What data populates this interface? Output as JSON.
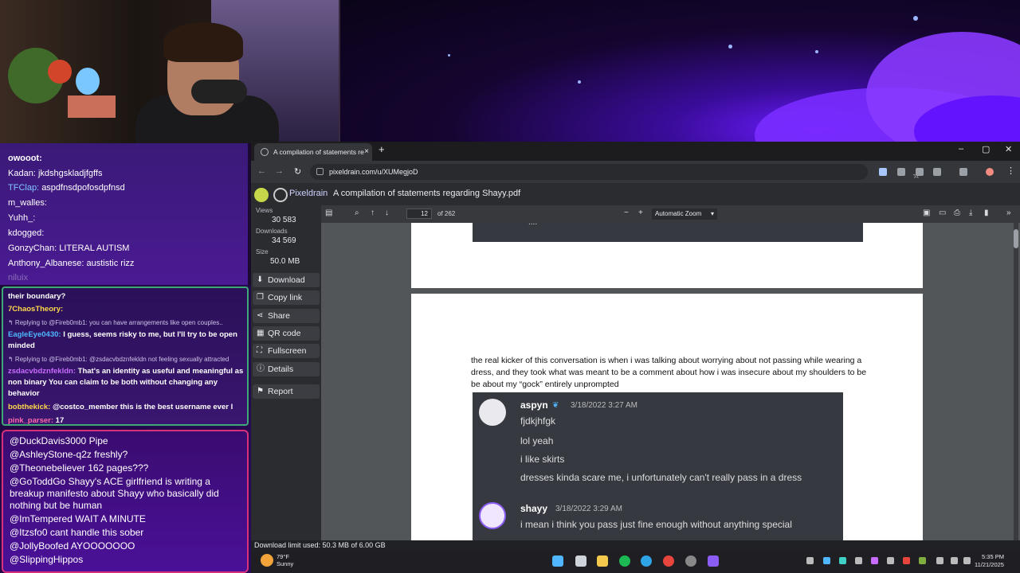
{
  "chat_top": [
    {
      "user": "owooot:",
      "msg": ""
    },
    {
      "user": "Kadan:",
      "msg": "jkdshgskladjfgffs"
    },
    {
      "user": "TFClap:",
      "msg": "aspdfnsdpofosdpfnsd"
    },
    {
      "user": "m_walles:",
      "msg": ""
    },
    {
      "user": "Yuhh_:",
      "msg": ""
    },
    {
      "user": "kdogged:",
      "msg": ""
    },
    {
      "user": "GonzyChan:",
      "msg": "LITERAL AUTISM"
    },
    {
      "user": "Anthony_Albanese:",
      "msg": "austistic rizz"
    },
    {
      "user": "niluix",
      "msg": ""
    }
  ],
  "chat_mid": {
    "l1": "their boundary?",
    "l2_user": "7ChaosTheory:",
    "l3_reply": "↰ Replying to @Fireb0mb1: you can have arrangements like open couples..",
    "l4_user": "EagleEye0430:",
    "l4_msg": "I guess, seems risky to me, but I'll try to be open minded",
    "l5_reply": "↰ Replying to @Fireb0mb1: @zsdacvbdznfekldn not feeling sexually attracted",
    "l6_user": "zsdacvbdznfekldn:",
    "l6_msg": "That's an identity as useful and meaningful as non binary  You can claim to be both without changing any behavior",
    "l7_user": "bobthekick:",
    "l7_msg": "@costco_member this is the best username ever l",
    "l8_user": "pink_parser:",
    "l8_msg": "17"
  },
  "chat_bottom": [
    {
      "user": "@DuckDavis3000",
      "msg": "Pipe"
    },
    {
      "user": "@AshleyStone-q2z",
      "msg": "freshly?"
    },
    {
      "user": "@Theonebeliever",
      "msg": "162 pages???"
    },
    {
      "user": "@GoToddGo",
      "msg": "Shayy's ACE girlfriend is writing a breakup manifesto about Shayy who basically did nothing but be human"
    },
    {
      "user": "@ImTempered",
      "msg": "WAIT A MINUTE"
    },
    {
      "user": "@Itzsfo0",
      "msg": "cant handle this sober"
    },
    {
      "user": "@JollyBoofed",
      "msg": "AYOOOOOOO"
    },
    {
      "user": "@SlippingHippos",
      "msg": ""
    }
  ],
  "browser": {
    "tab_title": "A compilation of statements re",
    "tab_close": "×",
    "new_tab": "+",
    "url": "pixeldrain.com/u/XUMegjoD",
    "win_min": "–",
    "win_max": "▢",
    "win_close": "✕",
    "back": "←",
    "forward": "→",
    "reload": "↻",
    "star": "☆",
    "menu": "⋮"
  },
  "pixeldrain": {
    "brand": "Pixeldrain",
    "file_title": "A compilation of statements regarding Shayy.pdf",
    "views_label": "Views",
    "views": "30 583",
    "downloads_label": "Downloads",
    "downloads": "34 569",
    "size_label": "Size",
    "size": "50.0 MB",
    "buttons": [
      "Download",
      "Copy link",
      "Share",
      "QR code",
      "Fullscreen",
      "Details",
      "Report"
    ]
  },
  "pdf": {
    "page": "12",
    "of_pages": "of 262",
    "zoom": "Automatic Zoom",
    "paragraph": "the real kicker of this conversation is when i was talking about worrying about not passing while wearing a dress, and they took what was meant to be a comment about how i was insecure about my shoulders to be be about my “gock” entirely unprompted",
    "ellipsis": "....",
    "msg1_user": "aspyn",
    "msg1_time": "3/18/2022 3:27 AM",
    "msg1_lines": [
      "fjdkjhfgk",
      "lol yeah",
      "i like skirts",
      "dresses kinda scare me, i unfortunately can't really pass in a dress"
    ],
    "msg2_user": "shayy",
    "msg2_time": "3/18/2022 3:29 AM",
    "msg2_lines": [
      "i mean i think you pass just fine enough without anything special"
    ]
  },
  "download_limit": "Download limit used: 50.3 MB of 6.00 GB",
  "taskbar": {
    "temp": "79°F",
    "weather": "Sunny",
    "time": "5:35 PM",
    "date": "11/21/2025"
  },
  "colors": {
    "accent_cyan": "#4fb6ff",
    "discord_bg": "#36393f",
    "chat_border_green": "#3fa878",
    "chat_border_pink": "#d8307a"
  }
}
